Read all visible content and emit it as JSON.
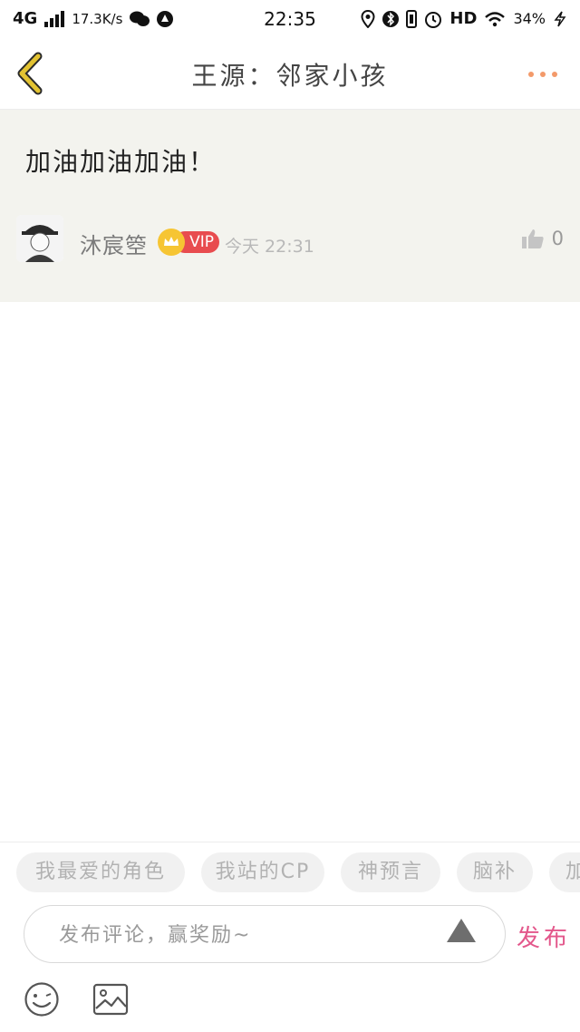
{
  "status_bar": {
    "network": "4G",
    "speed": "17.3K/s",
    "time": "22:35",
    "hd": "HD",
    "battery": "34%"
  },
  "header": {
    "title": "王源：邻家小孩",
    "back_icon": "chevron-left-icon",
    "more_icon": "more-dots-icon"
  },
  "post": {
    "content": "加油加油加油！",
    "author": "沐宸箜",
    "vip_label": "VIP",
    "time": "今天 22:31",
    "likes": "0"
  },
  "tags": [
    {
      "label": "我最爱的角色"
    },
    {
      "label": "我站的CP"
    },
    {
      "label": "神预言"
    },
    {
      "label": "脑补"
    },
    {
      "label": "加"
    }
  ],
  "comment": {
    "placeholder": "发布评论，赢奖励~",
    "publish_label": "发布"
  },
  "colors": {
    "accent_yellow": "#e3c332",
    "more_orange": "#f39a6a",
    "publish_pink": "#e3578b",
    "vip_red": "#e84c4f",
    "post_bg": "#f3f3ee"
  }
}
